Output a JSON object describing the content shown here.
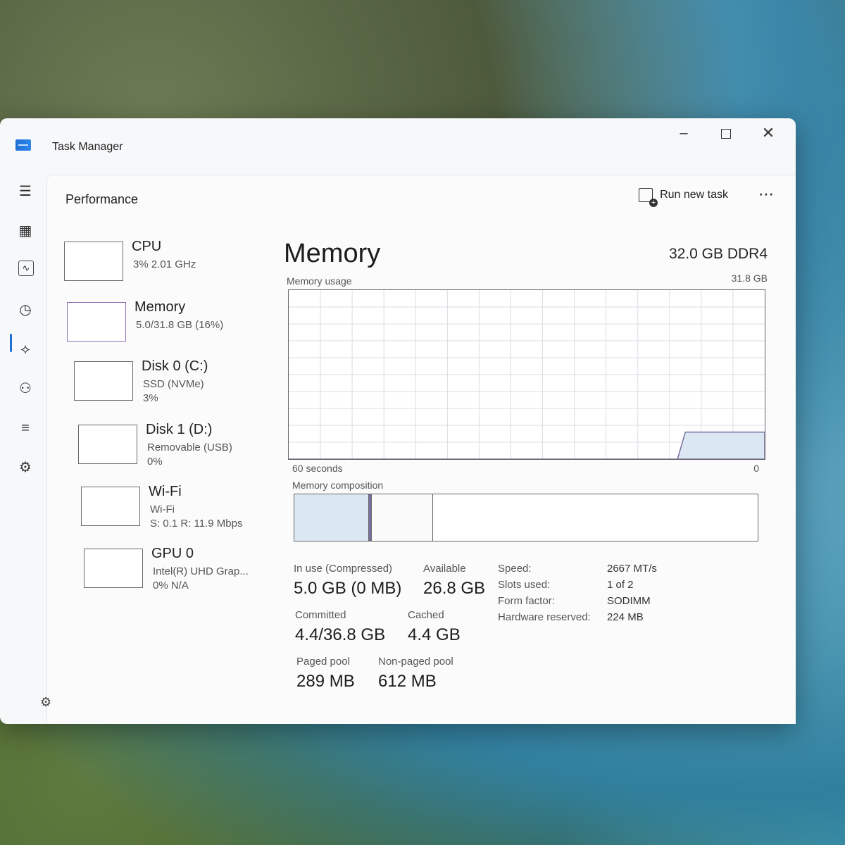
{
  "window": {
    "title": "Task Manager"
  },
  "header": {
    "title": "Performance",
    "run_new_task": "Run new task",
    "more": "⋯"
  },
  "nav": {
    "icons": [
      "menu-icon",
      "processes-icon",
      "performance-icon",
      "app-history-icon",
      "startup-apps-icon",
      "users-icon",
      "details-icon",
      "services-icon"
    ],
    "settings_icon": "settings-icon"
  },
  "devices": [
    {
      "name": "CPU",
      "sub1": "3% 2.01 GHz",
      "sub2": ""
    },
    {
      "name": "Memory",
      "sub1": "5.0/31.8 GB (16%)",
      "sub2": ""
    },
    {
      "name": "Disk 0 (C:)",
      "sub1": "SSD (NVMe)",
      "sub2": "3%"
    },
    {
      "name": "Disk 1 (D:)",
      "sub1": "Removable (USB)",
      "sub2": "0%"
    },
    {
      "name": "Wi-Fi",
      "sub1": "Wi-Fi",
      "sub2": "S: 0.1 R: 11.9 Mbps"
    },
    {
      "name": "GPU 0",
      "sub1": "Intel(R) UHD Grap...",
      "sub2": "0% N/A"
    }
  ],
  "memory": {
    "title": "Memory",
    "type": "32.0 GB DDR4",
    "usage_label": "Memory usage",
    "usage_max": "31.8 GB",
    "axis_left": "60 seconds",
    "axis_right": "0",
    "composition_label": "Memory composition",
    "composition": {
      "in_use_fraction": 0.16,
      "modified_fraction": 0.005,
      "standby_fraction": 0.13
    },
    "usage_history_fraction": [
      0,
      0,
      0,
      0,
      0,
      0,
      0,
      0,
      0,
      0,
      0,
      0,
      0,
      0,
      0,
      0,
      0,
      0,
      0,
      0,
      0,
      0,
      0,
      0,
      0,
      0,
      0,
      0,
      0,
      0,
      0,
      0,
      0,
      0,
      0,
      0,
      0,
      0,
      0,
      0,
      0,
      0,
      0,
      0,
      0,
      0,
      0,
      0,
      0,
      0,
      0.16,
      0.16,
      0.16,
      0.16,
      0.16,
      0.16,
      0.16,
      0.16,
      0.16,
      0.16,
      0.16
    ],
    "stats": {
      "in_use_label": "In use (Compressed)",
      "in_use": "5.0 GB (0 MB)",
      "available_label": "Available",
      "available": "26.8 GB",
      "committed_label": "Committed",
      "committed": "4.4/36.8 GB",
      "cached_label": "Cached",
      "cached": "4.4 GB",
      "paged_label": "Paged pool",
      "paged": "289 MB",
      "nonpaged_label": "Non-paged pool",
      "nonpaged": "612 MB"
    },
    "details": [
      {
        "key": "Speed:",
        "value": "2667 MT/s"
      },
      {
        "key": "Slots used:",
        "value": "1 of 2"
      },
      {
        "key": "Form factor:",
        "value": "SODIMM"
      },
      {
        "key": "Hardware reserved:",
        "value": "224 MB"
      }
    ]
  },
  "colors": {
    "accent": "#1f6fd1",
    "graph_line": "#7a6da0",
    "graph_fill": "#dbe7f2"
  }
}
